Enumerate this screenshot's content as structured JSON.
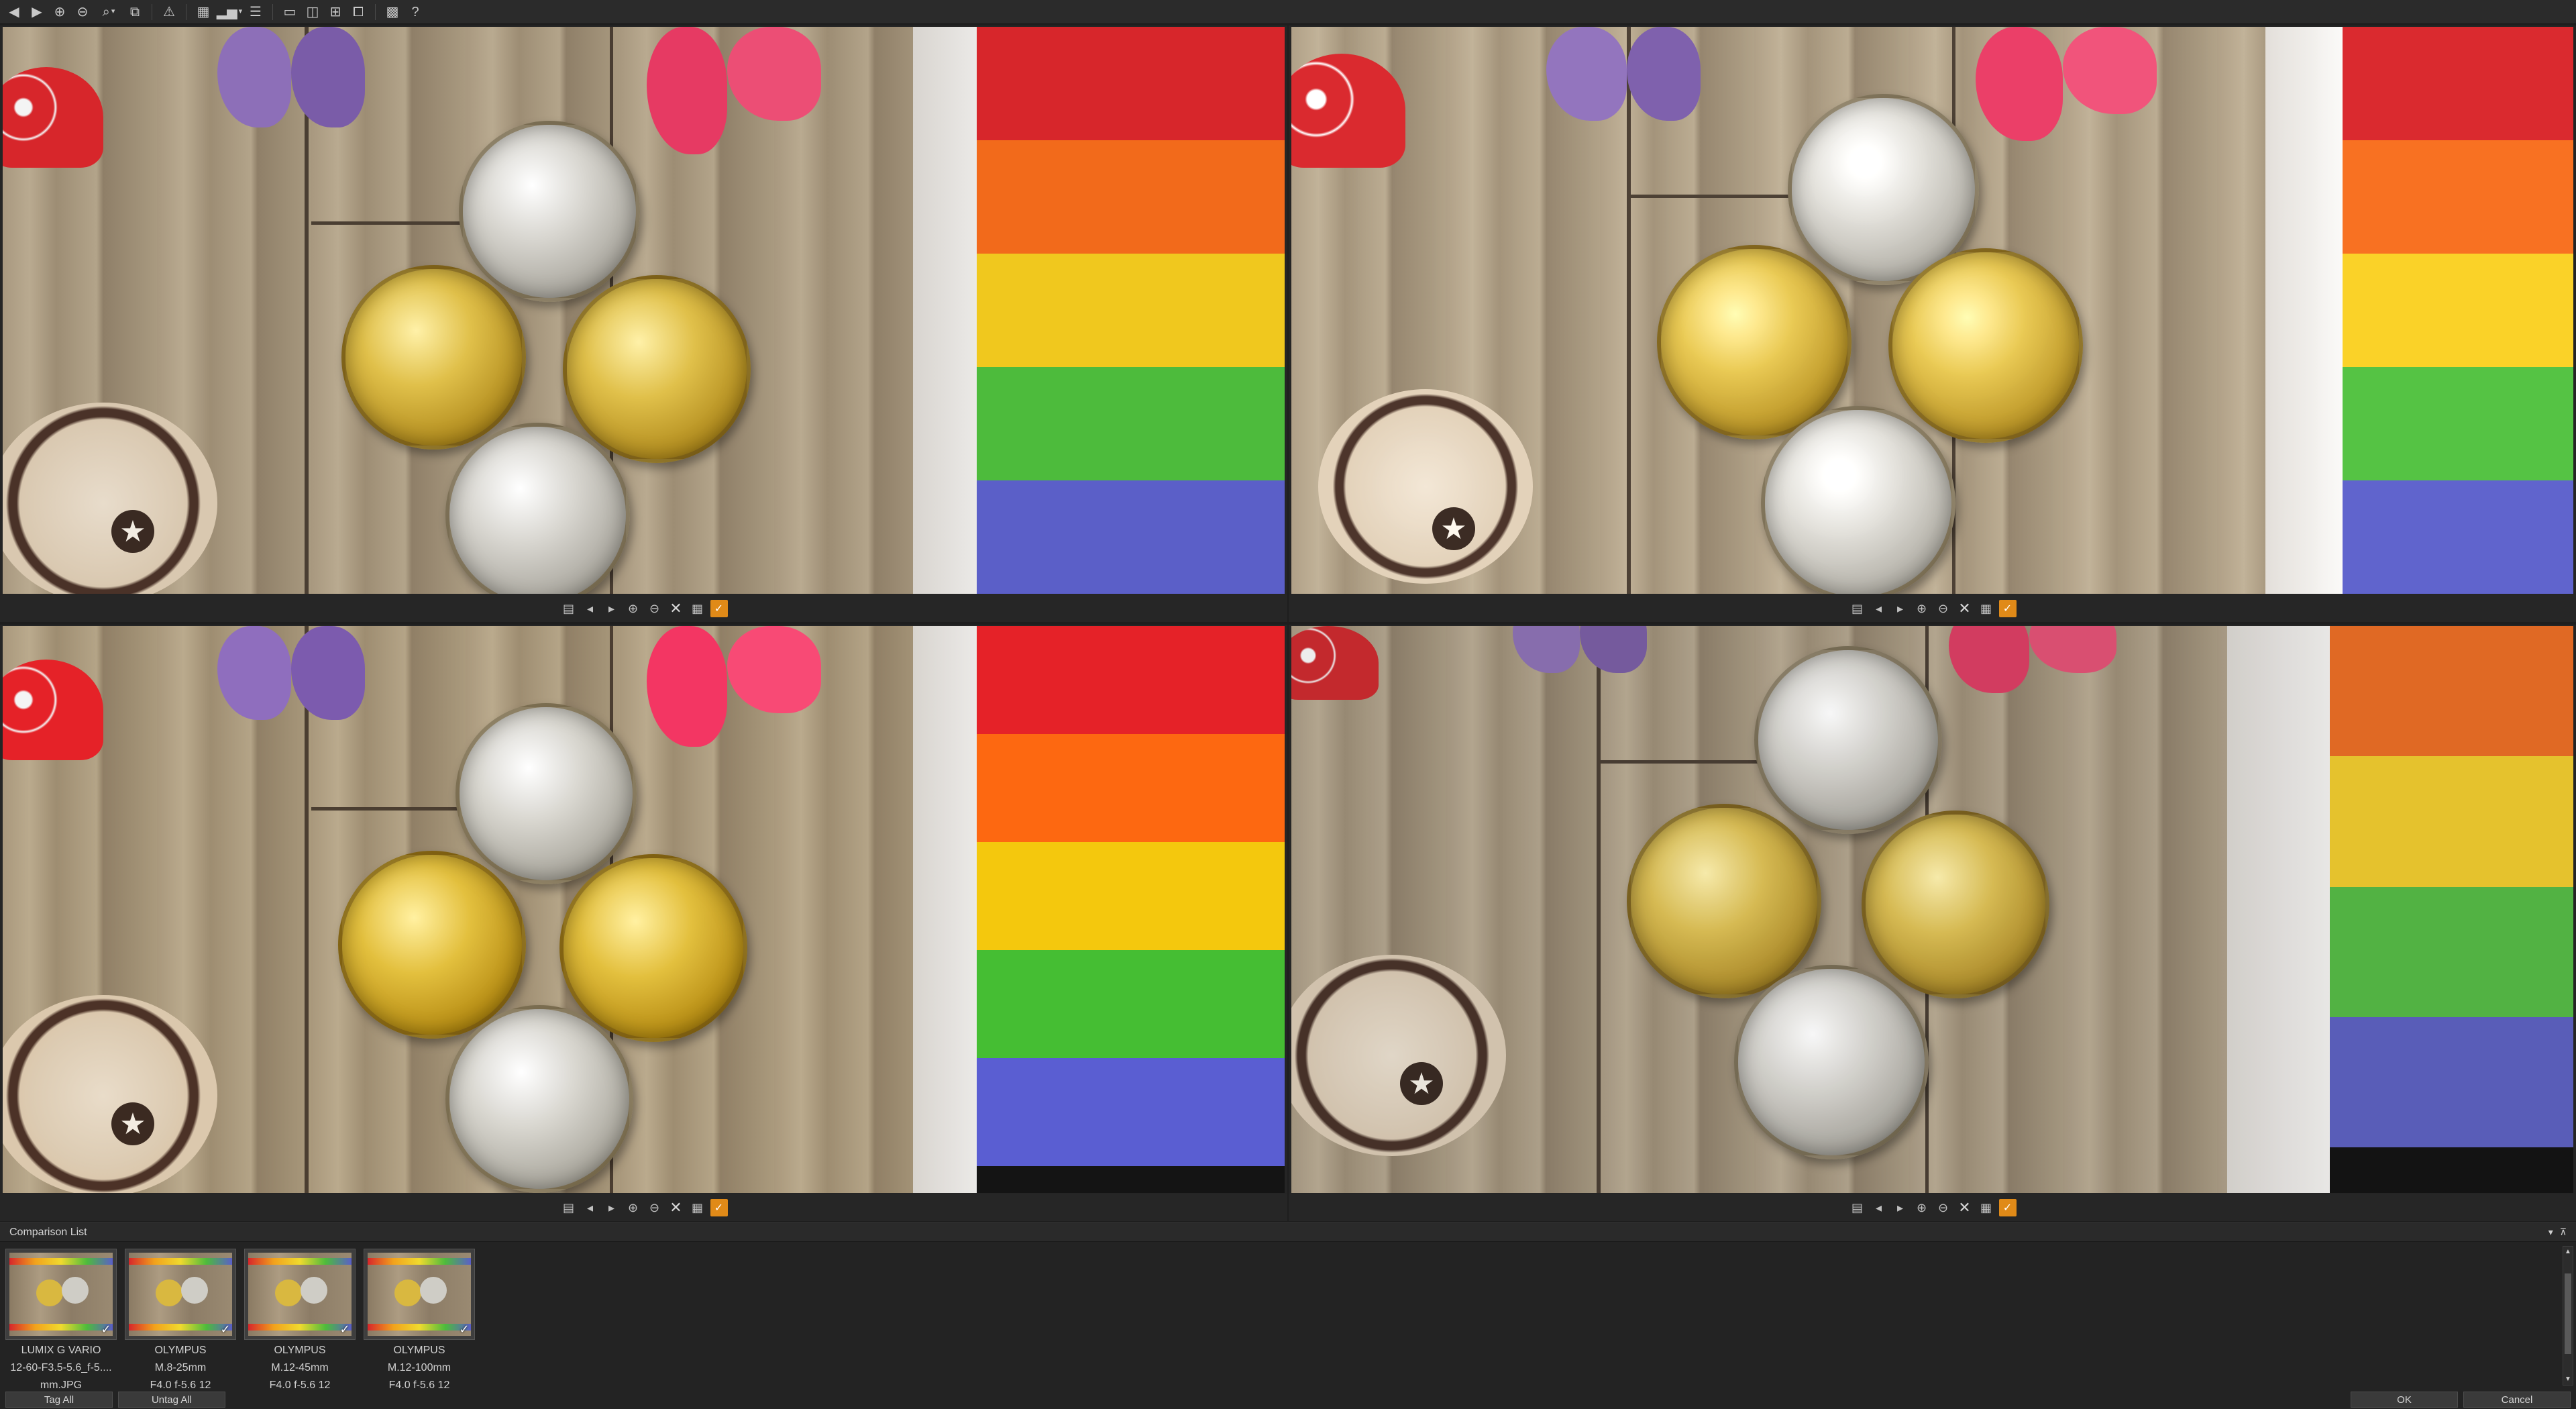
{
  "top_toolbar": {
    "items": [
      {
        "name": "back-icon",
        "glyph": "◀"
      },
      {
        "name": "forward-icon",
        "glyph": "▶"
      },
      {
        "name": "zoom-in-icon",
        "glyph": "⊕"
      },
      {
        "name": "zoom-out-icon",
        "glyph": "⊖"
      },
      {
        "name": "zoom-dropdown-icon",
        "glyph": "⌕"
      },
      {
        "name": "sync-view-icon",
        "glyph": "⧉"
      },
      {
        "name": "warning-icon",
        "glyph": "⚠"
      },
      {
        "name": "layout-icon",
        "glyph": "▦"
      },
      {
        "name": "histogram-icon",
        "glyph": "▂▅"
      },
      {
        "name": "info-panel-icon",
        "glyph": "☰"
      },
      {
        "name": "single-view-icon",
        "glyph": "▭"
      },
      {
        "name": "two-view-icon",
        "glyph": "◫"
      },
      {
        "name": "four-view-icon",
        "glyph": "⊞"
      },
      {
        "name": "multi-view-icon",
        "glyph": "⧠"
      },
      {
        "name": "grid-view-icon",
        "glyph": "▩"
      },
      {
        "name": "help-icon",
        "glyph": "?"
      }
    ]
  },
  "pane_toolbar": {
    "save_glyph": "▤",
    "prev_glyph": "◂",
    "next_glyph": "▸",
    "zoom_in_glyph": "⊕",
    "zoom_out_glyph": "⊖",
    "remove_glyph": "✕",
    "grid_glyph": "▦",
    "tag_glyph": "✓"
  },
  "comparison_list": {
    "title": "Comparison List",
    "collapse_glyph": "▾",
    "pin_glyph": "⊼",
    "thumbnails": [
      {
        "line1": "LUMIX G VARIO",
        "line2": "12-60-F3.5-5.6_f-5....",
        "line3": "mm.JPG",
        "checked": "✓"
      },
      {
        "line1": "OLYMPUS",
        "line2": "M.8-25mm",
        "line3": "F4.0 f-5.6 12",
        "checked": "✓"
      },
      {
        "line1": "OLYMPUS",
        "line2": "M.12-45mm",
        "line3": "F4.0 f-5.6 12",
        "checked": "✓"
      },
      {
        "line1": "OLYMPUS",
        "line2": "M.12-100mm",
        "line3": "F4.0 f-5.6 12",
        "checked": "✓"
      }
    ],
    "tag_all": "Tag All",
    "untag_all": "Untag All",
    "ok": "OK",
    "cancel": "Cancel",
    "scroll_up": "▲",
    "scroll_down": "▼"
  },
  "colors": {
    "tag_accent": "#e08a18",
    "sock_red": "#d7262b",
    "sock_orange": "#f26a1b",
    "sock_yellow": "#f0c81e",
    "sock_green": "#4dbb3c",
    "sock_blue": "#5b5fc8"
  }
}
